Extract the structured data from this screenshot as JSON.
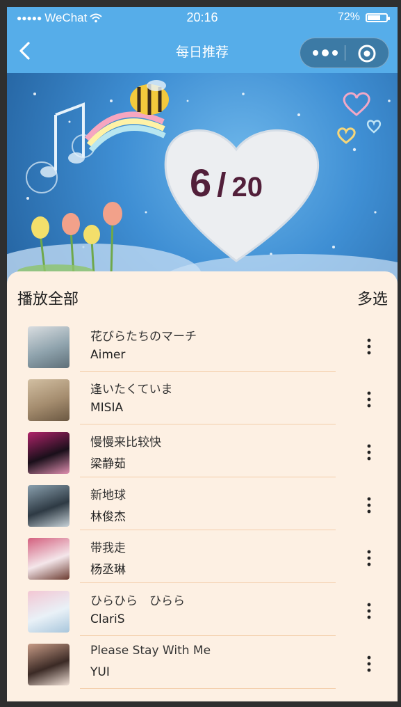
{
  "status_bar": {
    "carrier": "WeChat",
    "time": "20:16",
    "battery_text": "72%",
    "battery_level": 0.72
  },
  "nav": {
    "title": "每日推荐"
  },
  "banner": {
    "day": "6",
    "separator": "/",
    "month": "20"
  },
  "list_header": {
    "play_all": "播放全部",
    "multi_select": "多选"
  },
  "songs": [
    {
      "title": "花びらたちのマーチ",
      "artist": "Aimer",
      "cover_colors": [
        "#8fa3ad",
        "#d9dde0",
        "#5e6f78"
      ]
    },
    {
      "title": "逢いたくていま",
      "artist": "MISIA",
      "cover_colors": [
        "#a48c6e",
        "#d2bfa2",
        "#6b5842"
      ]
    },
    {
      "title": "慢慢来比较快",
      "artist": "梁静茹",
      "cover_colors": [
        "#1a0f1a",
        "#b0246a",
        "#e08fb0"
      ]
    },
    {
      "title": "新地球",
      "artist": "林俊杰",
      "cover_colors": [
        "#2e3a44",
        "#8aa0ae",
        "#c7d2d8"
      ]
    },
    {
      "title": "带我走",
      "artist": "杨丞琳",
      "cover_colors": [
        "#f4e6ea",
        "#d35f7e",
        "#6b3a2f"
      ]
    },
    {
      "title": "ひらひら　ひらら",
      "artist": "ClariS",
      "cover_colors": [
        "#e9f1f7",
        "#f3c6d3",
        "#a8c6dc"
      ]
    },
    {
      "title": "Please Stay With Me",
      "artist": "YUI",
      "cover_colors": [
        "#3b2a25",
        "#c79b86",
        "#f0e0d6"
      ]
    }
  ],
  "colors": {
    "header_blue": "#56ade9",
    "list_background": "#fdf0e3",
    "divider": "#f3cda9",
    "date_text": "#521f3a"
  }
}
